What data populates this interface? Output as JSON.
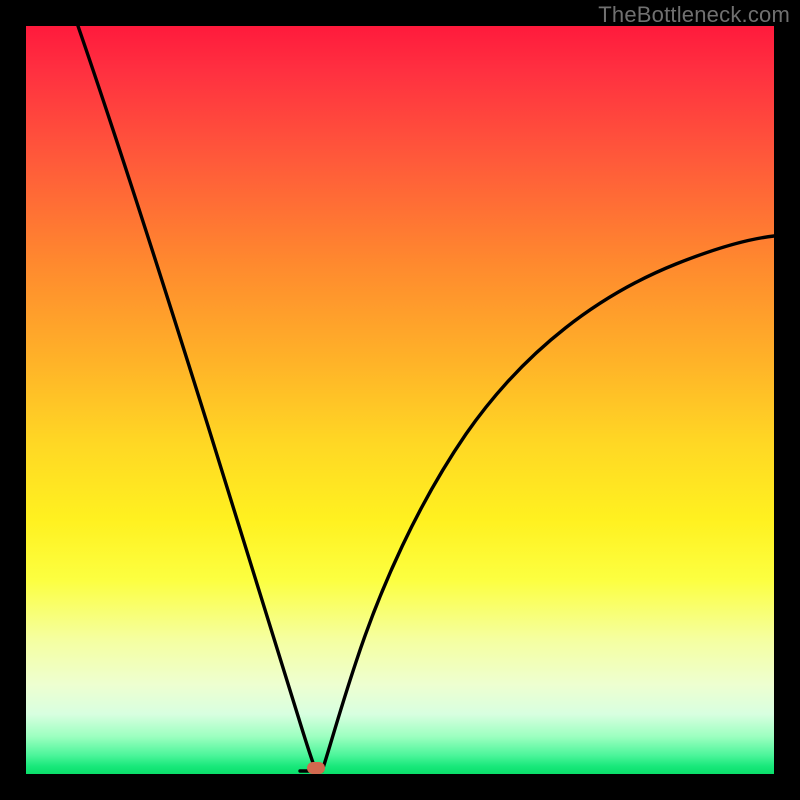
{
  "watermark": "TheBottleneck.com",
  "chart_data": {
    "type": "line",
    "title": "",
    "xlabel": "",
    "ylabel": "",
    "xlim": [
      0,
      100
    ],
    "ylim": [
      0,
      100
    ],
    "background_gradient": {
      "top": "#ff1a3c",
      "bottom": "#0adf6a",
      "meaning": "red = high bottleneck, green = low bottleneck"
    },
    "series": [
      {
        "name": "bottleneck-curve",
        "x": [
          0,
          5,
          10,
          15,
          20,
          25,
          30,
          34,
          37,
          38.5,
          40,
          44,
          50,
          56,
          62,
          70,
          78,
          86,
          94,
          100
        ],
        "y": [
          100,
          86,
          73,
          60,
          47,
          34,
          20,
          9,
          2,
          0,
          1,
          7,
          17,
          26,
          34,
          43,
          51,
          57,
          63,
          67
        ]
      }
    ],
    "marker": {
      "name": "optimal-point",
      "x": 38.5,
      "y": 0,
      "color": "#d2694f"
    }
  }
}
